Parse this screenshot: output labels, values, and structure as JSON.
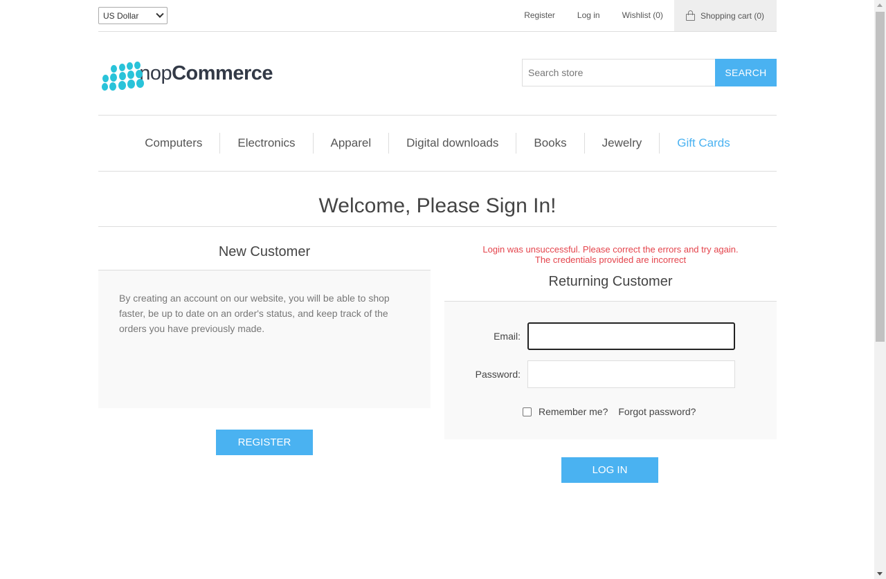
{
  "header": {
    "currency": "US Dollar",
    "links": {
      "register": "Register",
      "login": "Log in",
      "wishlist": "Wishlist (0)",
      "cart": "Shopping cart (0)"
    }
  },
  "logo": {
    "text_light": "nop",
    "text_bold": "Commerce"
  },
  "search": {
    "placeholder": "Search store",
    "button": "SEARCH"
  },
  "menu": {
    "items": [
      "Computers",
      "Electronics",
      "Apparel",
      "Digital downloads",
      "Books",
      "Jewelry",
      "Gift Cards"
    ],
    "active": "Gift Cards"
  },
  "page_title": "Welcome, Please Sign In!",
  "new_customer": {
    "heading": "New Customer",
    "text": "By creating an account on our website, you will be able to shop faster, be up to date on an order's status, and keep track of the orders you have previously made.",
    "button": "REGISTER"
  },
  "returning_customer": {
    "errors": [
      "Login was unsuccessful. Please correct the errors and try again.",
      "The credentials provided are incorrect"
    ],
    "heading": "Returning Customer",
    "email_label": "Email:",
    "email_value": "",
    "password_label": "Password:",
    "password_value": "",
    "remember_label": "Remember me?",
    "remember_checked": false,
    "forgot_label": "Forgot password?",
    "button": "LOG IN"
  },
  "colors": {
    "accent": "#4ab2f1",
    "error": "#e4434b",
    "logo": "#29c3d9"
  }
}
